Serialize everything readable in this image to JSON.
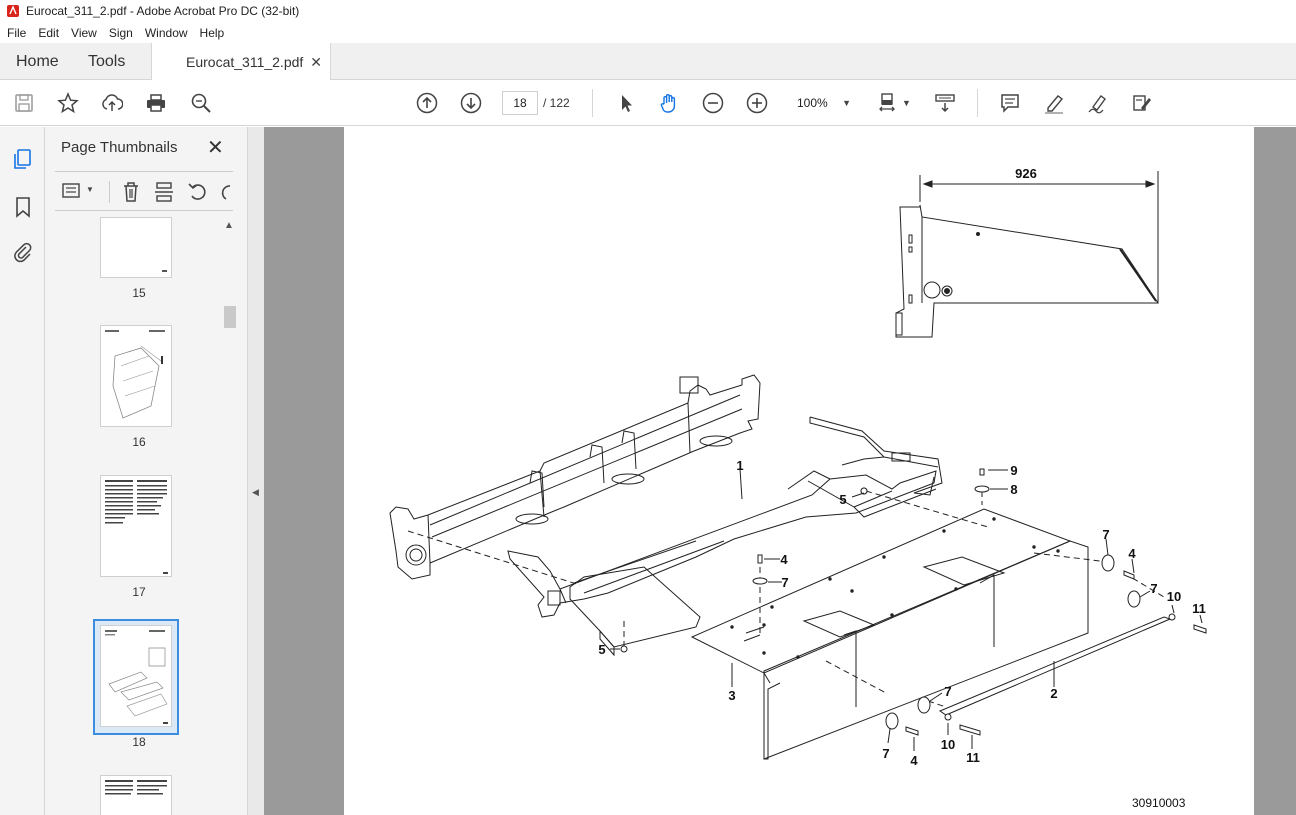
{
  "window": {
    "title": "Eurocat_311_2.pdf - Adobe Acrobat Pro DC (32-bit)"
  },
  "menu": [
    "File",
    "Edit",
    "View",
    "Sign",
    "Window",
    "Help"
  ],
  "tabs": {
    "home": "Home",
    "tools": "Tools",
    "document": "Eurocat_311_2.pdf"
  },
  "toolbar": {
    "current_page": "18",
    "total_pages": "/ 122",
    "zoom": "100%",
    "icons": [
      "save-icon",
      "star-icon",
      "upload-icon",
      "print-icon",
      "search-icon",
      "prev-page-icon",
      "next-page-icon",
      "select-icon",
      "hand-icon",
      "zoom-out-icon",
      "zoom-in-icon",
      "fit-page-icon",
      "scroll-mode-icon",
      "comment-icon",
      "highlight-icon",
      "sign-icon",
      "edit-pdf-icon"
    ]
  },
  "thumbnails_panel": {
    "title": "Page Thumbnails",
    "pages": [
      {
        "number": "15"
      },
      {
        "number": "16"
      },
      {
        "number": "17"
      },
      {
        "number": "18",
        "selected": true
      },
      {
        "number": ""
      }
    ]
  },
  "document": {
    "dimension_label": "926",
    "part_labels": [
      "1",
      "2",
      "3",
      "4",
      "5",
      "7",
      "8",
      "9",
      "10",
      "11"
    ],
    "drawing_id": "30910003"
  },
  "colors": {
    "selection": "#3b8de0",
    "workspace": "#9a9a9a",
    "acrobat_red": "#d9261c"
  }
}
